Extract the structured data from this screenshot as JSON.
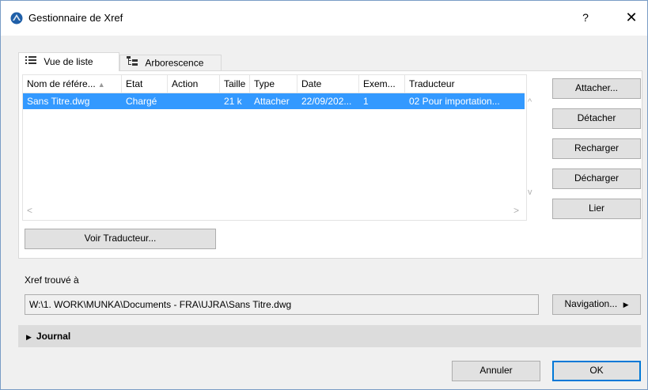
{
  "window": {
    "title": "Gestionnaire de Xref",
    "help_label": "?",
    "close_label": "✕"
  },
  "tabs": [
    {
      "label": "Vue de liste"
    },
    {
      "label": "Arborescence"
    }
  ],
  "list": {
    "headers": [
      "Nom de référe...",
      "Etat",
      "Action",
      "Taille",
      "Type",
      "Date",
      "Exem...",
      "Traducteur"
    ],
    "rows": [
      [
        "Sans Titre.dwg",
        "Chargé",
        "",
        "21 k",
        "Attacher",
        "22/09/202...",
        "1",
        "02 Pour importation..."
      ]
    ],
    "scroll_left": "<",
    "scroll_right": ">",
    "scroll_up": "^",
    "scroll_down": "v"
  },
  "buttons": {
    "attach": "Attacher...",
    "detach": "Détacher",
    "reload": "Recharger",
    "unload": "Décharger",
    "bind": "Lier",
    "view_translator": "Voir Traducteur...",
    "browse": "Navigation...",
    "cancel": "Annuler",
    "ok": "OK"
  },
  "found_at": {
    "label": "Xref trouvé à",
    "path": "W:\\1. WORK\\MUNKA\\Documents - FRA\\UJRA\\Sans Titre.dwg"
  },
  "journal": {
    "label": "Journal"
  },
  "colors": {
    "selection": "#3399ff",
    "ok_border": "#0078d7"
  }
}
